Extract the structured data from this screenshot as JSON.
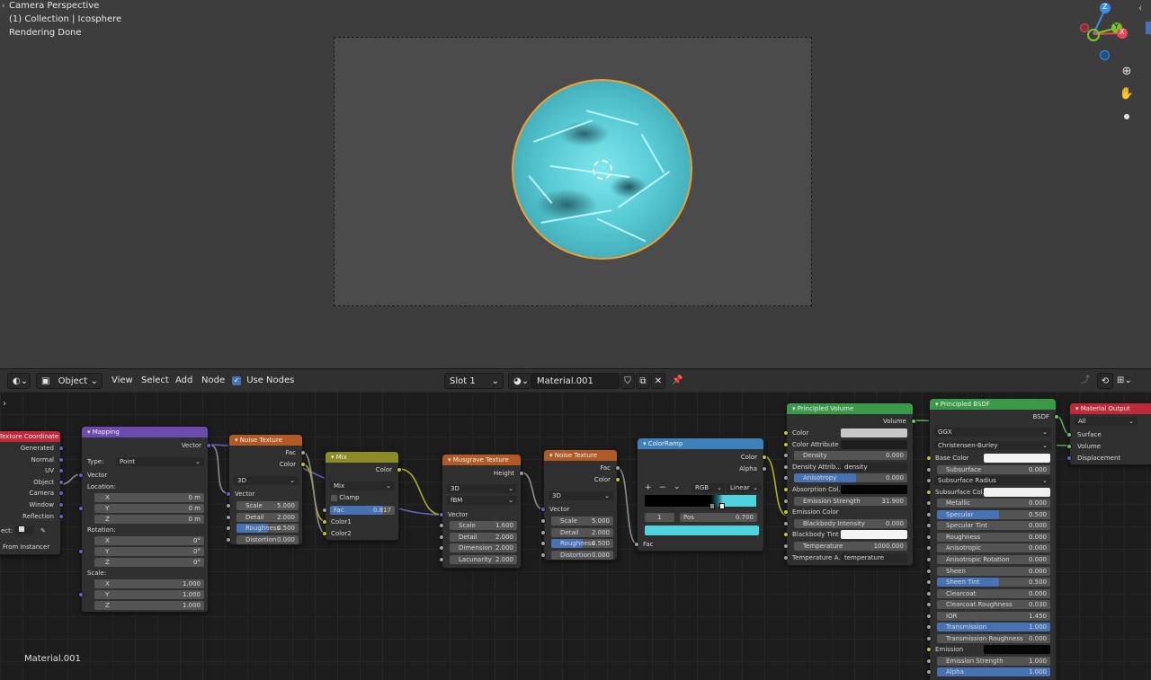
{
  "viewport": {
    "info_lines": [
      "Camera Perspective",
      "(1) Collection | Icosphere",
      "Rendering Done"
    ],
    "gizmo": {
      "axes": [
        "Z",
        "Y",
        "X"
      ],
      "colors": {
        "x": "#e84a55",
        "y": "#7bc426",
        "z": "#3a8ee6"
      }
    },
    "tools": [
      "zoom-icon",
      "hand-pan-icon",
      "camera-icon"
    ],
    "render_colors": {
      "sphere": "#56c9d3",
      "outline": "#f0a030"
    }
  },
  "header": {
    "mode": "Object",
    "menus": [
      "View",
      "Select",
      "Add",
      "Node"
    ],
    "use_nodes": {
      "label": "Use Nodes",
      "checked": true
    },
    "slot": "Slot 1",
    "material_name": "Material.001"
  },
  "canvas": {
    "material_label": "Material.001"
  },
  "nodes": {
    "texcoord": {
      "title": "Texture Coordinate",
      "outputs": [
        "Generated",
        "Normal",
        "UV",
        "Object",
        "Camera",
        "Window",
        "Reflection"
      ],
      "object_label": "ect:",
      "from_instancer": "From Instancer"
    },
    "mapping": {
      "title": "Mapping",
      "out": "Vector",
      "type_label": "Type:",
      "type_value": "Point",
      "in": "Vector",
      "location_label": "Location:",
      "rotation_label": "Rotation:",
      "scale_label": "Scale:",
      "location": [
        [
          "X",
          "0 m"
        ],
        [
          "Y",
          "0 m"
        ],
        [
          "Z",
          "0 m"
        ]
      ],
      "rotation": [
        [
          "X",
          "0°"
        ],
        [
          "Y",
          "0°"
        ],
        [
          "Z",
          "0°"
        ]
      ],
      "scale": [
        [
          "X",
          "1.000"
        ],
        [
          "Y",
          "1.000"
        ],
        [
          "Z",
          "1.000"
        ]
      ]
    },
    "noise1": {
      "title": "Noise Texture",
      "outputs": [
        "Fac",
        "Color"
      ],
      "dim": "3D",
      "in": "Vector",
      "fields": [
        [
          "Scale",
          "5.000"
        ],
        [
          "Detail",
          "2.000"
        ],
        [
          "Roughness",
          "0.500"
        ],
        [
          "Distortion",
          "0.000"
        ]
      ]
    },
    "mix": {
      "title": "Mix",
      "out": "Color",
      "blend": "Mix",
      "clamp": "Clamp",
      "fac_label": "Fac",
      "fac_value": "0.817",
      "fac": 0.817,
      "inputs": [
        "Color1",
        "Color2"
      ]
    },
    "musgrave": {
      "title": "Musgrave Texture",
      "out": "Height",
      "dim": "3D",
      "type": "fBM",
      "in": "Vector",
      "fields": [
        [
          "Scale",
          "1.600"
        ],
        [
          "Detail",
          "2.000"
        ],
        [
          "Dimension",
          "2.000"
        ],
        [
          "Lacunarity",
          "2.000"
        ]
      ]
    },
    "noise2": {
      "title": "Noise Texture",
      "outputs": [
        "Fac",
        "Color"
      ],
      "dim": "3D",
      "in": "Vector",
      "fields": [
        [
          "Scale",
          "5.000"
        ],
        [
          "Detail",
          "2.000"
        ],
        [
          "Roughness",
          "0.500"
        ],
        [
          "Distortion",
          "0.000"
        ]
      ]
    },
    "colorramp": {
      "title": "ColorRamp",
      "outputs": [
        "Color",
        "Alpha"
      ],
      "plus": "+",
      "minus": "−",
      "chev": "⌄",
      "mode": "RGB",
      "interp": "Linear",
      "index": "1",
      "pos_label": "Pos",
      "pos_value": "0.700",
      "in": "Fac",
      "stop_color": "#4fd3dc"
    },
    "volume": {
      "title": "Principled Volume",
      "out": "Volume",
      "rows": [
        {
          "label": "Color",
          "kind": "swatch",
          "color": "#c8c8c8"
        },
        {
          "label": "Color Attribute",
          "kind": "swatch",
          "color": "#1e1e1e"
        },
        {
          "label": "Density",
          "kind": "field",
          "value": "0.000"
        },
        {
          "label": "Density Attrib...",
          "kind": "text",
          "value": "density"
        },
        {
          "label": "Anisotropy",
          "kind": "field",
          "value": "0.000",
          "blue": true
        },
        {
          "label": "Absorption Col...",
          "kind": "swatch",
          "color": "#050505"
        },
        {
          "label": "Emission Strength",
          "kind": "field",
          "value": "31.900"
        },
        {
          "label": "Emission Color",
          "kind": "label"
        },
        {
          "label": "Blackbody Intensity",
          "kind": "field",
          "value": "0.000"
        },
        {
          "label": "Blackbody Tint",
          "kind": "swatch",
          "color": "#f4f4f4"
        },
        {
          "label": "Temperature",
          "kind": "field",
          "value": "1000.000"
        },
        {
          "label": "Temperature A...",
          "kind": "text",
          "value": "temperature"
        }
      ]
    },
    "bsdf": {
      "title": "Principled BSDF",
      "out": "BSDF",
      "dist": "GGX",
      "sss": "Christensen-Burley",
      "rows": [
        {
          "label": "Base Color",
          "kind": "swatch",
          "color": "#f4f4f4"
        },
        {
          "label": "Subsurface",
          "kind": "field",
          "value": "0.000"
        },
        {
          "label": "Subsurface Radius",
          "kind": "select"
        },
        {
          "label": "Subsurface Col...",
          "kind": "swatch",
          "color": "#f0f0f0"
        },
        {
          "label": "Metallic",
          "kind": "field",
          "value": "0.000"
        },
        {
          "label": "Specular",
          "kind": "field",
          "value": "0.500",
          "blue": true
        },
        {
          "label": "Specular Tint",
          "kind": "field",
          "value": "0.000"
        },
        {
          "label": "Roughness",
          "kind": "field",
          "value": "0.000"
        },
        {
          "label": "Anisotropic",
          "kind": "field",
          "value": "0.000"
        },
        {
          "label": "Anisotropic Rotation",
          "kind": "field",
          "value": "0.000"
        },
        {
          "label": "Sheen",
          "kind": "field",
          "value": "0.000"
        },
        {
          "label": "Sheen Tint",
          "kind": "field",
          "value": "0.500",
          "blue": true
        },
        {
          "label": "Clearcoat",
          "kind": "field",
          "value": "0.000"
        },
        {
          "label": "Clearcoat Roughness",
          "kind": "field",
          "value": "0.030"
        },
        {
          "label": "IOR",
          "kind": "field",
          "value": "1.450"
        },
        {
          "label": "Transmission",
          "kind": "field",
          "value": "1.000",
          "blue": true
        },
        {
          "label": "Transmission Roughness",
          "kind": "field",
          "value": "0.000"
        },
        {
          "label": "Emission",
          "kind": "swatch",
          "color": "#050505"
        },
        {
          "label": "Emission Strength",
          "kind": "field",
          "value": "1.000"
        },
        {
          "label": "Alpha",
          "kind": "field",
          "value": "1.000",
          "blue": true
        }
      ]
    },
    "output": {
      "title": "Material Output",
      "target": "All",
      "inputs": [
        "Surface",
        "Volume",
        "Displacement"
      ]
    }
  }
}
